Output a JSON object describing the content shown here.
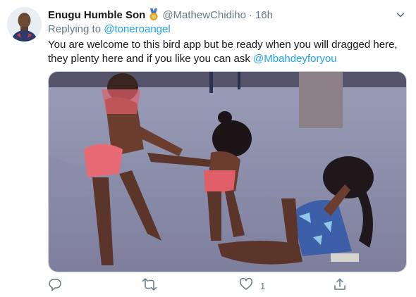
{
  "tweet": {
    "display_name": "Enugu Humble Son",
    "handle": "@MathewChidiho",
    "separator": "·",
    "time": "16h",
    "replying_prefix": "Replying to ",
    "replying_to": "@toneroangel",
    "text_line1": "You are welcome to this bird app but be ready when you will dragged here,",
    "text_line2_prefix": "they plenty here and if you like you can ask ",
    "text_mention": "@Mbahdeyforyou"
  },
  "actions": {
    "reply_icon": "reply-icon",
    "retweet_icon": "retweet-icon",
    "like_icon": "heart-icon",
    "like_count": "1",
    "share_icon": "share-icon"
  },
  "colors": {
    "link": "#1da1f2",
    "secondary_text": "#657786",
    "primary_text": "#14171a",
    "badge_gold": "#e0a230"
  }
}
